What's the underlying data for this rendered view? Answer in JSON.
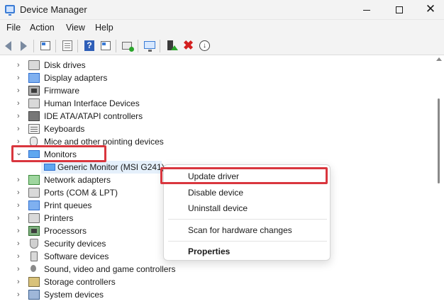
{
  "window": {
    "title": "Device Manager",
    "minimize_glyph": "",
    "close_glyph": "✕"
  },
  "menu": {
    "items": [
      "File",
      "Action",
      "View",
      "Help"
    ]
  },
  "toolbar": {
    "icons": [
      "back-arrow-icon",
      "forward-arrow-icon",
      "show-hide-console-tree-icon",
      "properties-icon",
      "help-icon",
      "view-icon",
      "scan-hardware-icon",
      "monitor-icon",
      "update-driver-icon",
      "uninstall-icon",
      "download-icon"
    ],
    "help_glyph": "?",
    "uninstall_glyph": "✖",
    "download_glyph": "↓"
  },
  "tree": {
    "chevron_collapsed": "›",
    "chevron_expanded": "⌄",
    "items": [
      {
        "label": "Disk drives",
        "icon": "disk-drive-icon"
      },
      {
        "label": "Display adapters",
        "icon": "display-adapter-icon"
      },
      {
        "label": "Firmware",
        "icon": "firmware-icon"
      },
      {
        "label": "Human Interface Devices",
        "icon": "hid-icon"
      },
      {
        "label": "IDE ATA/ATAPI controllers",
        "icon": "ide-controller-icon"
      },
      {
        "label": "Keyboards",
        "icon": "keyboard-icon"
      },
      {
        "label": "Mice and other pointing devices",
        "icon": "mouse-icon"
      },
      {
        "label": "Monitors",
        "icon": "monitor-icon",
        "expanded": true
      },
      {
        "label": "Network adapters",
        "icon": "network-adapter-icon"
      },
      {
        "label": "Ports (COM & LPT)",
        "icon": "port-icon"
      },
      {
        "label": "Print queues",
        "icon": "print-queue-icon"
      },
      {
        "label": "Printers",
        "icon": "printer-icon"
      },
      {
        "label": "Processors",
        "icon": "processor-icon"
      },
      {
        "label": "Security devices",
        "icon": "security-device-icon"
      },
      {
        "label": "Software devices",
        "icon": "software-device-icon"
      },
      {
        "label": "Sound, video and game controllers",
        "icon": "sound-controller-icon"
      },
      {
        "label": "Storage controllers",
        "icon": "storage-controller-icon"
      },
      {
        "label": "System devices",
        "icon": "system-device-icon"
      }
    ],
    "monitor_child": "Generic Monitor (MSI G241)"
  },
  "context_menu": {
    "items": [
      {
        "label": "Update driver",
        "highlighted": true
      },
      {
        "label": "Disable device"
      },
      {
        "label": "Uninstall device"
      },
      {
        "label": "Scan for hardware changes"
      },
      {
        "label": "Properties",
        "bold": true
      }
    ]
  },
  "colors": {
    "highlight_border": "#d9363e",
    "selection_bg": "#e5f0fb",
    "accent": "#3a7bd5"
  }
}
